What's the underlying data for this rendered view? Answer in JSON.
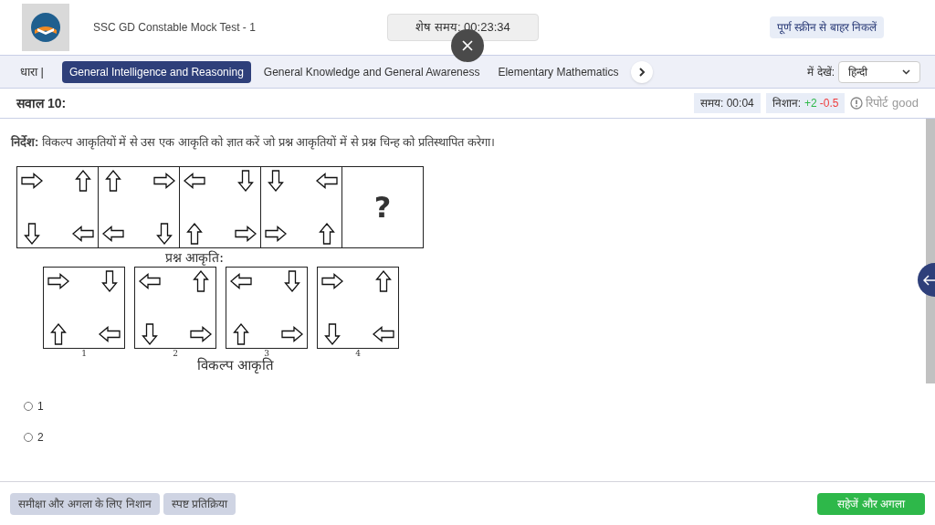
{
  "header": {
    "title": "SSC GD Constable Mock Test - 1",
    "timer": "शेष समय: 00:23:34",
    "exit_button": "पूर्ण स्क्रीन से बाहर निकलें"
  },
  "sections": {
    "label": "धारा |",
    "tabs": [
      {
        "label": "General Intelligence and Reasoning",
        "selected": true
      },
      {
        "label": "General Knowledge and General Awareness",
        "selected": false
      },
      {
        "label": "Elementary Mathematics",
        "selected": false
      }
    ],
    "view_label": "में देखें:",
    "language": "हिन्दी"
  },
  "question": {
    "number": "सवाल 10:",
    "time": "समय: 00:04",
    "marks_label": "निशान:",
    "positive": "+2",
    "negative": "-0.5",
    "report": "रिपोर्ट good"
  },
  "instruction": "**निर्देश:** विकल्प आकृतियों में से उस एक आकृति को ज्ञात करें जो प्रश्न आकृतियों में से प्रश्न चिन्ह को प्रतिस्थापित करेगा।",
  "figure": {
    "question_figures": [
      {
        "kind": "arrows",
        "arrows": [
          {
            "kind": "right"
          },
          {
            "kind": "up"
          },
          {
            "kind": "down"
          },
          {
            "kind": "left"
          }
        ]
      },
      {
        "kind": "arrows",
        "arrows": [
          {
            "kind": "up"
          },
          {
            "kind": "right"
          },
          {
            "kind": "left"
          },
          {
            "kind": "down"
          }
        ]
      },
      {
        "kind": "arrows",
        "arrows": [
          {
            "kind": "left"
          },
          {
            "kind": "down"
          },
          {
            "kind": "up"
          },
          {
            "kind": "right"
          }
        ]
      },
      {
        "kind": "arrows",
        "arrows": [
          {
            "kind": "down"
          },
          {
            "kind": "left"
          },
          {
            "kind": "right"
          },
          {
            "kind": "up"
          }
        ]
      },
      {
        "kind": "unknown",
        "symbol": "?"
      }
    ],
    "question_caption": "प्रश्न आकृति:",
    "answer_figures": [
      {
        "number": "1",
        "arrows": [
          {
            "kind": "right"
          },
          {
            "kind": "down"
          },
          {
            "kind": "up"
          },
          {
            "kind": "left"
          }
        ]
      },
      {
        "number": "2",
        "arrows": [
          {
            "kind": "left"
          },
          {
            "kind": "up"
          },
          {
            "kind": "down"
          },
          {
            "kind": "right"
          }
        ]
      },
      {
        "number": "3",
        "arrows": [
          {
            "kind": "left"
          },
          {
            "kind": "down"
          },
          {
            "kind": "up"
          },
          {
            "kind": "right"
          }
        ]
      },
      {
        "number": "4",
        "arrows": [
          {
            "kind": "right"
          },
          {
            "kind": "up"
          },
          {
            "kind": "down"
          },
          {
            "kind": "left"
          }
        ]
      }
    ],
    "answer_caption": "विकल्प आकृति"
  },
  "options": [
    {
      "label": "1",
      "selected": false
    },
    {
      "label": "2",
      "selected": false
    }
  ],
  "footer": {
    "mark_button": "समीक्षा और अगला के लिए निशान",
    "clear_button": "स्पष्ट प्रतिक्रिया",
    "save_button": "सहेजें और अगला"
  }
}
